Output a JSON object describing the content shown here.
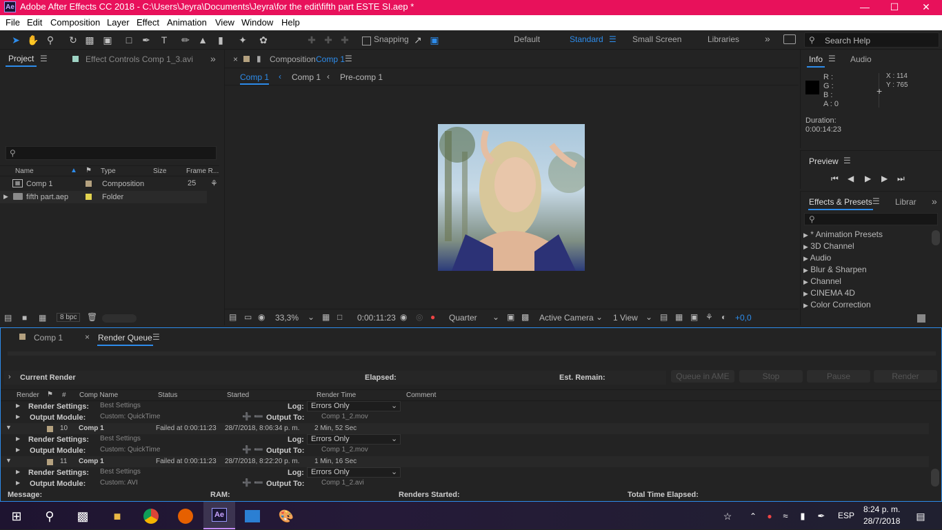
{
  "window": {
    "title": "Adobe After Effects CC 2018 - C:\\Users\\Jeyra\\Documents\\Jeyra\\for the edit\\fifth part ESTE SI.aep *",
    "app_icon": "Ae"
  },
  "menu": [
    "File",
    "Edit",
    "Composition",
    "Layer",
    "Effect",
    "Animation",
    "View",
    "Window",
    "Help"
  ],
  "toolbar": {
    "snapping": "Snapping",
    "workspaces": [
      "Default",
      "Standard",
      "Small Screen",
      "Libraries"
    ],
    "search_placeholder": "Search Help"
  },
  "project": {
    "tab": "Project",
    "effect_controls": "Effect Controls Comp 1_3.avi",
    "columns": [
      "Name",
      "Type",
      "Size",
      "Frame R..."
    ],
    "items": [
      {
        "name": "Comp 1",
        "type": "Composition",
        "rate": "25",
        "color": "#b4a17f"
      },
      {
        "name": "fifth part.aep",
        "type": "Folder",
        "rate": "",
        "color": "#e2d34f"
      }
    ],
    "bpc": "8 bpc"
  },
  "composition": {
    "tab_prefix": "Composition",
    "tab_name": "Comp 1",
    "breadcrumbs": [
      "Comp 1",
      "Comp 1",
      "Pre-comp 1"
    ],
    "zoom": "33,3%",
    "timecode": "0:00:11:23",
    "resolution": "Quarter",
    "camera": "Active Camera",
    "views": "1 View",
    "exposure": "+0,0"
  },
  "info": {
    "tab": "Info",
    "tab2": "Audio",
    "r": "R :",
    "g": "G :",
    "b": "B :",
    "a": "A :  0",
    "x": "X : 114",
    "y": "Y : 765",
    "duration_label": "Duration:",
    "duration": "0:00:14:23"
  },
  "preview": {
    "title": "Preview"
  },
  "effects": {
    "tab": "Effects & Presets",
    "tab2": "Librar",
    "items": [
      "* Animation Presets",
      "3D Channel",
      "Audio",
      "Blur & Sharpen",
      "Channel",
      "CINEMA 4D",
      "Color Correction"
    ]
  },
  "render": {
    "tab1": "Comp 1",
    "tab2": "Render Queue",
    "current_render": "Current Render",
    "elapsed": "Elapsed:",
    "est_remain": "Est. Remain:",
    "buttons": [
      "Queue in AME",
      "Stop",
      "Pause",
      "Render"
    ],
    "columns": [
      "Render",
      "#",
      "Comp Name",
      "Status",
      "Started",
      "Render Time",
      "Comment"
    ],
    "rs_label": "Render Settings:",
    "om_label": "Output Module:",
    "log_label": "Log:",
    "output_to_label": "Output To:",
    "rows": [
      {
        "kind": "sub",
        "rs": "Best Settings",
        "om": "Custom: QuickTime",
        "log": "Errors Only",
        "out": "Comp 1_2.mov"
      },
      {
        "kind": "item",
        "num": "10",
        "name": "Comp 1",
        "status": "Failed at 0:00:11:23",
        "started": "28/7/2018, 8:06:34 p. m.",
        "time": "2 Min, 52 Sec",
        "rs": "Best Settings",
        "om": "Custom: QuickTime",
        "log": "Errors Only",
        "out": "Comp 1_2.mov"
      },
      {
        "kind": "item",
        "num": "11",
        "name": "Comp 1",
        "status": "Failed at 0:00:11:23",
        "started": "28/7/2018, 8:22:20 p. m.",
        "time": "1 Min, 16 Sec",
        "rs": "Best Settings",
        "om": "Custom: AVI",
        "log": "Errors Only",
        "out": "Comp 1_2.avi"
      }
    ],
    "status_bar": {
      "message": "Message:",
      "ram": "RAM:",
      "renders_started": "Renders Started:",
      "total_time": "Total Time Elapsed:"
    }
  },
  "taskbar": {
    "lang": "ESP",
    "time": "8:24 p. m.",
    "date": "28/7/2018"
  },
  "colors": {
    "titlebar": "#e8115b",
    "accent": "#2d8ceb",
    "panel": "#232323"
  }
}
